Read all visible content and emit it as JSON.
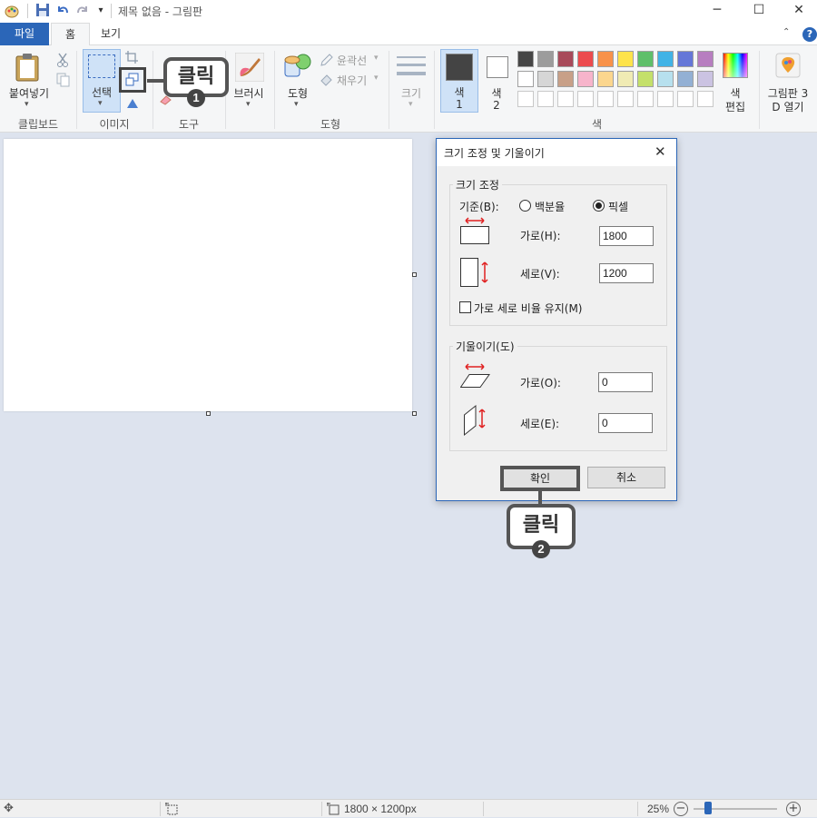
{
  "titlebar": {
    "title": "제목 없음 - 그림판"
  },
  "tabs": [
    {
      "label": "파일"
    },
    {
      "label": "홈"
    },
    {
      "label": "보기"
    }
  ],
  "ribbon": {
    "clipboard": {
      "paste": "붙여넣기",
      "group": "클립보드"
    },
    "image": {
      "select": "선택",
      "group": "이미지"
    },
    "tools": {
      "group": "도구"
    },
    "brush": {
      "label": "브러시"
    },
    "shapes": {
      "label": "도형",
      "outline": "윤곽선",
      "fill": "채우기",
      "group": "도형"
    },
    "size": {
      "label": "크기"
    },
    "color1": {
      "line1": "색",
      "line2": "1"
    },
    "color2": {
      "line1": "색",
      "line2": "2"
    },
    "edit_colors": {
      "line1": "색",
      "line2": "편집"
    },
    "colors_group": "색",
    "paint3d": {
      "line1": "그림판 3",
      "line2": "D 열기"
    },
    "palette_row1": [
      "#464646",
      "#9c9c9c",
      "#a84a5a",
      "#ec4b4e",
      "#f8924a",
      "#fde34b",
      "#5fbf6a",
      "#41b3e6",
      "#6577d8",
      "#b77ec0"
    ],
    "palette_row2": [
      "#ffffff",
      "#d6d6d6",
      "#c8a088",
      "#f7b4cb",
      "#fbd68e",
      "#f0ebb4",
      "#c4e06a",
      "#b7e0ee",
      "#93b0d4",
      "#cbc3e2"
    ]
  },
  "dialog": {
    "title": "크기 조정 및 기울이기",
    "resize": {
      "legend": "크기 조정",
      "by_label": "기준(B):",
      "percent_label": "백분율",
      "pixels_label": "픽셀",
      "selected": "pixels",
      "horizontal_label": "가로(H):",
      "horizontal_value": "1800",
      "vertical_label": "세로(V):",
      "vertical_value": "1200",
      "keep_ratio_label": "가로 세로 비율 유지(M)",
      "keep_ratio_checked": false
    },
    "skew": {
      "legend": "기울이기(도)",
      "horizontal_label": "가로(O):",
      "horizontal_value": "0",
      "vertical_label": "세로(E):",
      "vertical_value": "0"
    },
    "ok_label": "확인",
    "cancel_label": "취소"
  },
  "callouts": [
    {
      "text": "클릭",
      "number": "1"
    },
    {
      "text": "클릭",
      "number": "2"
    }
  ],
  "statusbar": {
    "dimensions": "1800 × 1200px",
    "zoom": "25%"
  },
  "colors": {
    "accent": "#2b66b8",
    "arrow": "#e02020"
  }
}
